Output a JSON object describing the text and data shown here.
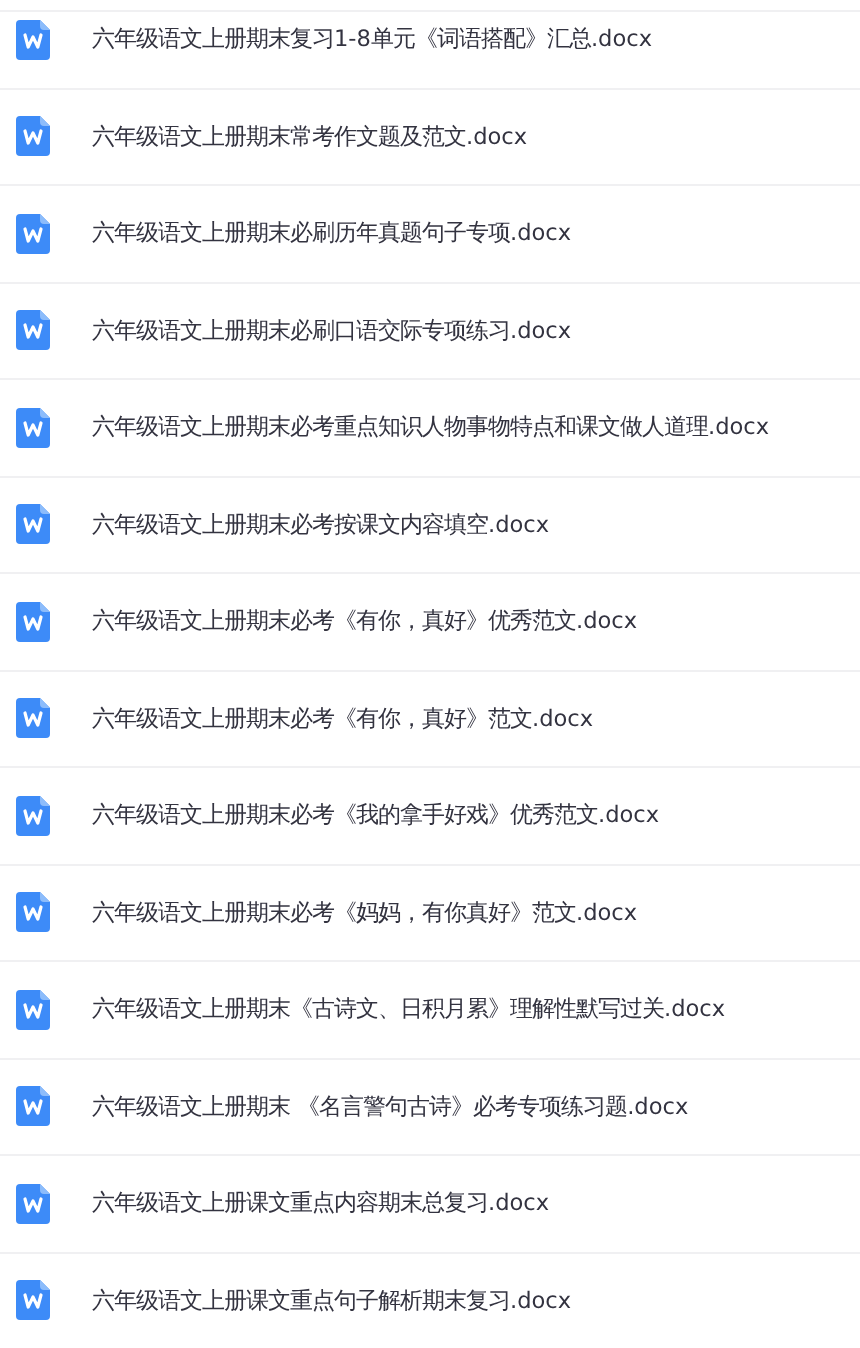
{
  "files": [
    {
      "name": "六年级语文上册期末复习1-8单元《词语搭配》汇总.docx",
      "kind": "word"
    },
    {
      "name": "六年级语文上册期末常考作文题及范文.docx",
      "kind": "word"
    },
    {
      "name": "六年级语文上册期末必刷历年真题句子专项.docx",
      "kind": "word"
    },
    {
      "name": "六年级语文上册期末必刷口语交际专项练习.docx",
      "kind": "word"
    },
    {
      "name": "六年级语文上册期末必考重点知识人物事物特点和课文做人道理.docx",
      "kind": "word"
    },
    {
      "name": "六年级语文上册期末必考按课文内容填空.docx",
      "kind": "word"
    },
    {
      "name": "六年级语文上册期末必考《有你，真好》优秀范文.docx",
      "kind": "word"
    },
    {
      "name": "六年级语文上册期末必考《有你，真好》范文.docx",
      "kind": "word"
    },
    {
      "name": "六年级语文上册期末必考《我的拿手好戏》优秀范文.docx",
      "kind": "word"
    },
    {
      "name": "六年级语文上册期末必考《妈妈，有你真好》范文.docx",
      "kind": "word"
    },
    {
      "name": "六年级语文上册期末《古诗文、日积月累》理解性默写过关.docx",
      "kind": "word"
    },
    {
      "name": "六年级语文上册期末 《名言警句古诗》必考专项练习题.docx",
      "kind": "word"
    },
    {
      "name": "六年级语文上册课文重点内容期末总复习.docx",
      "kind": "word"
    },
    {
      "name": "六年级语文上册课文重点句子解析期末复习.docx",
      "kind": "word"
    }
  ]
}
